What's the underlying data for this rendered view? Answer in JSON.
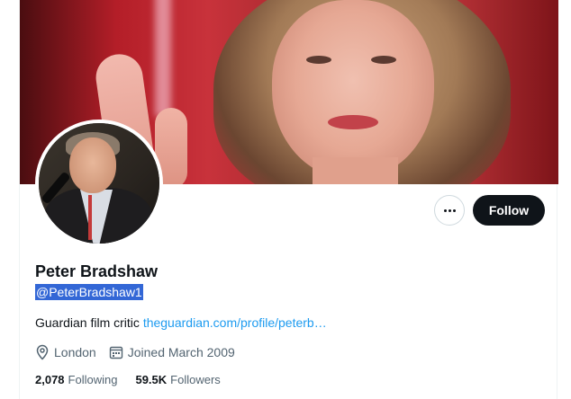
{
  "profile": {
    "name": "Peter Bradshaw",
    "handle": "@PeterBradshaw1",
    "bio_text": "Guardian film critic",
    "bio_link": "theguardian.com/profile/peterb…",
    "location": "London",
    "joined": "Joined March 2009"
  },
  "stats": {
    "following_count": "2,078",
    "following_label": "Following",
    "followers_count": "59.5K",
    "followers_label": "Followers"
  },
  "actions": {
    "follow_label": "Follow",
    "more_icon": "more-dots-icon"
  },
  "icons": {
    "location": "location-pin-icon",
    "calendar": "calendar-icon"
  },
  "colors": {
    "accent": "#1d9bf0",
    "follow_bg": "#0f1419",
    "text_secondary": "#536471",
    "selection": "#3367d6"
  }
}
